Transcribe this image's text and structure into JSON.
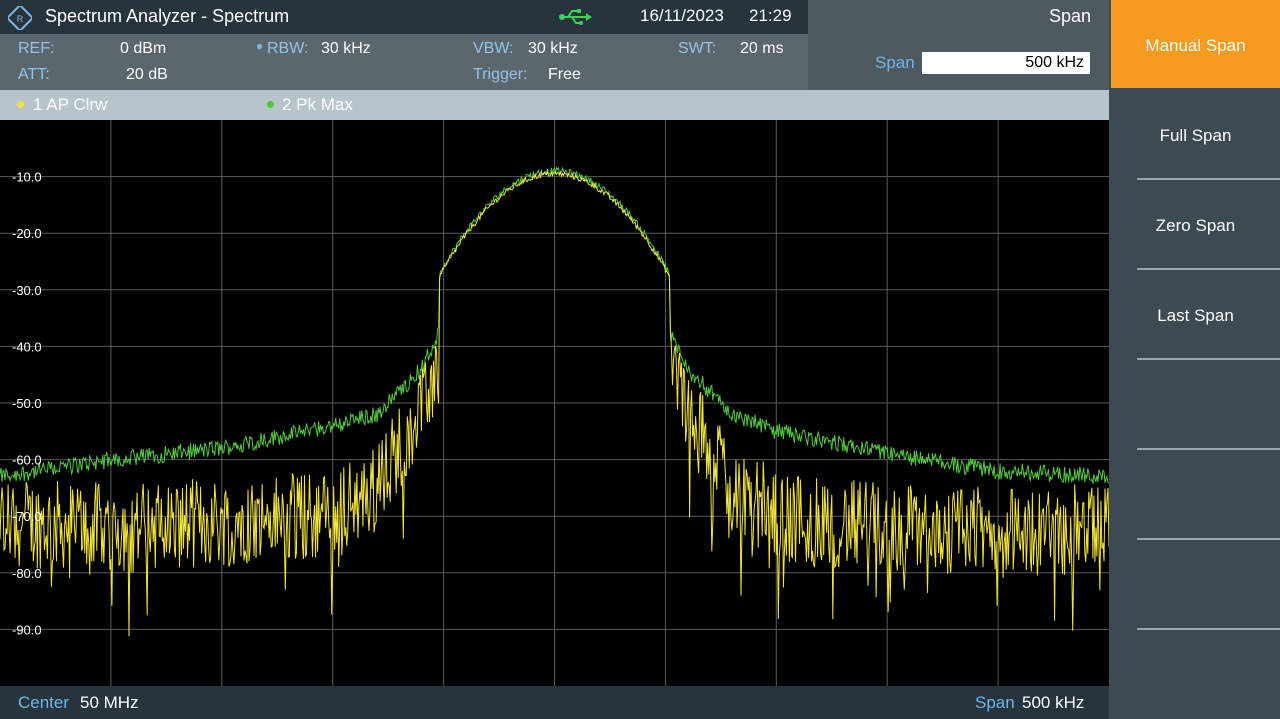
{
  "title_bar": {
    "app_title": "Spectrum Analyzer - Spectrum",
    "date": "16/11/2023",
    "time": "21:29",
    "usb_icon": "usb-icon"
  },
  "mode_panel": {
    "mode": "Span",
    "span_label": "Span",
    "span_value": "500 kHz"
  },
  "settings": {
    "ref_label": "REF:",
    "ref_value": "0 dBm",
    "att_label": "ATT:",
    "att_value": "20 dB",
    "rbw_label": "RBW:",
    "rbw_value": "30 kHz",
    "vbw_label": "VBW:",
    "vbw_value": "30 kHz",
    "trigger_label": "Trigger:",
    "trigger_value": "Free",
    "swt_label": "SWT:",
    "swt_value": "20 ms"
  },
  "traces": [
    {
      "label": "1 AP  Clrw",
      "color": "#f2e33c"
    },
    {
      "label": "2 Pk  Max",
      "color": "#52c93a"
    }
  ],
  "plot": {
    "y_ticks": [
      "-10.0",
      "-20.0",
      "-30.0",
      "-40.0",
      "-50.0",
      "-60.0",
      "-70.0",
      "-80.0",
      "-90.0"
    ],
    "y_top_dbm": 0,
    "y_bottom_dbm": -100,
    "x_divisions": 10,
    "y_divisions": 10,
    "grid_color": "#5a5a5a"
  },
  "chart_data": {
    "type": "line",
    "center": "50 MHz",
    "span": "500 kHz",
    "x_unit": "MHz",
    "y_unit": "dBm",
    "xlim": [
      49.75,
      50.25
    ],
    "ylim": [
      -100,
      0
    ],
    "series": [
      {
        "name": "1 AP  Clrw",
        "color": "#f2e33c",
        "x": [
          49.75,
          49.8,
          49.85,
          49.9,
          49.92,
          49.94,
          49.96,
          49.98,
          50.0,
          50.02,
          50.04,
          50.06,
          50.08,
          50.1,
          50.15,
          50.2,
          50.25
        ],
        "values": [
          -71,
          -72,
          -71,
          -70,
          -65,
          -50,
          -30,
          -15,
          -9,
          -15,
          -30,
          -50,
          -64,
          -70,
          -72,
          -73,
          -72
        ]
      },
      {
        "name": "2 Pk  Max",
        "color": "#52c93a",
        "x": [
          49.75,
          49.8,
          49.85,
          49.9,
          49.92,
          49.94,
          49.96,
          49.98,
          50.0,
          50.02,
          50.04,
          50.06,
          50.08,
          50.1,
          50.15,
          50.2,
          50.25
        ],
        "values": [
          -63,
          -60,
          -58,
          -54,
          -52,
          -44,
          -28,
          -14,
          -9,
          -14,
          -28,
          -44,
          -52,
          -55,
          -59,
          -62,
          -63
        ]
      }
    ]
  },
  "bottom_bar": {
    "center_label": "Center",
    "center_value": "50 MHz",
    "span_label": "Span",
    "span_value": "500 kHz"
  },
  "softkeys": [
    "Manual Span",
    "Full Span",
    "Zero Span",
    "Last Span"
  ]
}
